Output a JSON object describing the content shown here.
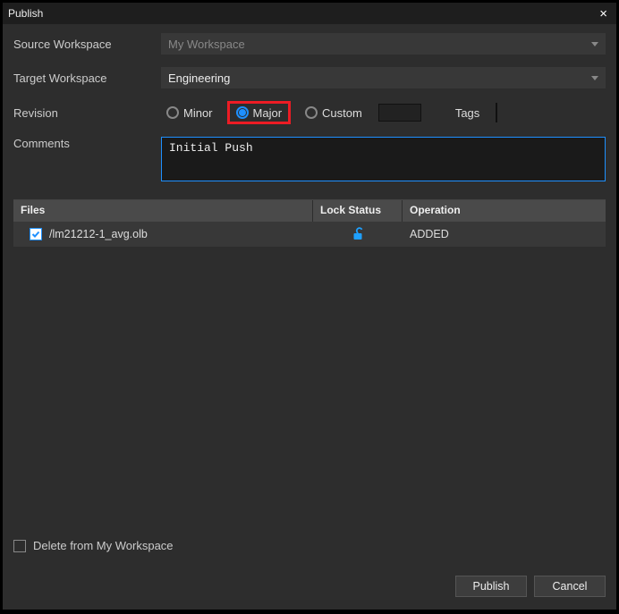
{
  "dialog": {
    "title": "Publish",
    "close": "×"
  },
  "form": {
    "source_label": "Source Workspace",
    "source_value": "My Workspace",
    "target_label": "Target Workspace",
    "target_value": "Engineering",
    "revision_label": "Revision",
    "revision": {
      "minor": "Minor",
      "major": "Major",
      "custom": "Custom",
      "custom_value": "",
      "selected": "major"
    },
    "tags_label": "Tags",
    "tags_value": "",
    "comments_label": "Comments",
    "comments_value": "Initial Push"
  },
  "table": {
    "headers": {
      "files": "Files",
      "lock": "Lock Status",
      "operation": "Operation"
    },
    "rows": [
      {
        "checked": true,
        "file": "/lm21212-1_avg.olb",
        "lock": "unlocked",
        "operation": "ADDED"
      }
    ]
  },
  "footer": {
    "delete_label": "Delete from My Workspace",
    "publish": "Publish",
    "cancel": "Cancel"
  }
}
